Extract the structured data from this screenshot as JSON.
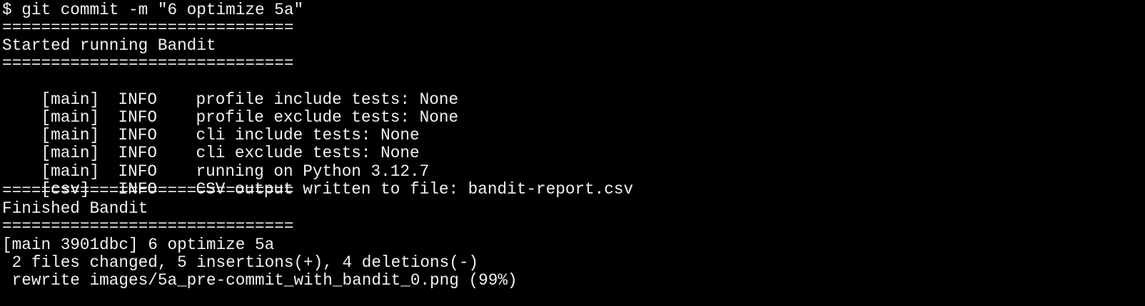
{
  "terminal": {
    "colors": {
      "background": "#000000",
      "foreground": "#f2f2f2",
      "previous_output": "#c8b400"
    },
    "command_line": "$ git commit -m \"6 optimize 5a\"",
    "separator": "==============================",
    "bandit_start": "Started running Bandit",
    "log": [
      {
        "tag": "[main]",
        "level": "INFO",
        "message": "profile include tests: None"
      },
      {
        "tag": "[main]",
        "level": "INFO",
        "message": "profile exclude tests: None"
      },
      {
        "tag": "[main]",
        "level": "INFO",
        "message": "cli include tests: None"
      },
      {
        "tag": "[main]",
        "level": "INFO",
        "message": "cli exclude tests: None"
      },
      {
        "tag": "[main]",
        "level": "INFO",
        "message": "running on Python 3.12.7"
      },
      {
        "tag": "[csv]",
        "level": "INFO",
        "message": "CSV output written to file: bandit-report.csv"
      }
    ],
    "bandit_end": "Finished Bandit",
    "commit_summary": "[main 3901dbc] 6 optimize 5a",
    "changes_stat": " 2 files changed, 5 insertions(+), 4 deletions(-)",
    "rewrite_line": " rewrite images/5a_pre-commit_with_bandit_0.png (99%)"
  }
}
